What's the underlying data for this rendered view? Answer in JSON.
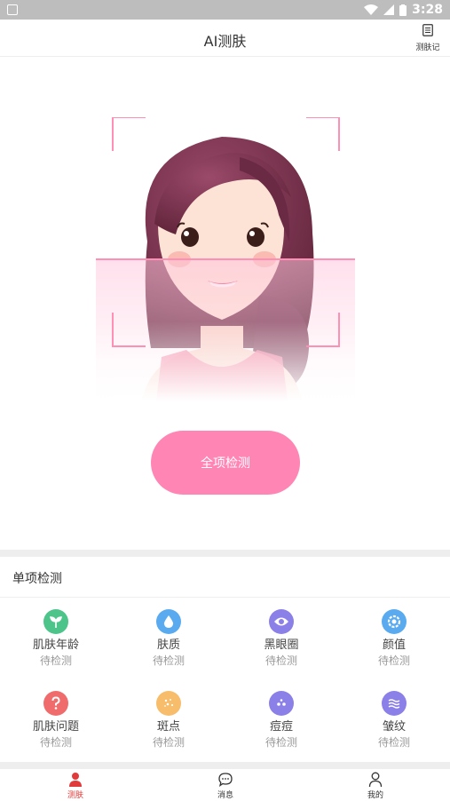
{
  "status_bar": {
    "time": "3:28"
  },
  "header": {
    "title": "AI测肤",
    "record_label": "测肤记"
  },
  "hero": {
    "cta_label": "全项检测"
  },
  "single_tests": {
    "section_title": "单项检测",
    "items": [
      {
        "name": "肌肤年龄",
        "status": "待检测",
        "icon": "sprout-icon",
        "color": "#4cc48a"
      },
      {
        "name": "肤质",
        "status": "待检测",
        "icon": "water-drop-icon",
        "color": "#5aaaf0"
      },
      {
        "name": "黑眼圈",
        "status": "待检测",
        "icon": "eye-icon",
        "color": "#8b7fe8"
      },
      {
        "name": "颜值",
        "status": "待检测",
        "icon": "flower-icon",
        "color": "#5aaaf0"
      },
      {
        "name": "肌肤问题",
        "status": "待检测",
        "icon": "question-icon",
        "color": "#f06c6c"
      },
      {
        "name": "斑点",
        "status": "待检测",
        "icon": "spots-icon",
        "color": "#f7bd6a"
      },
      {
        "name": "痘痘",
        "status": "待检测",
        "icon": "acne-icon",
        "color": "#8b7fe8"
      },
      {
        "name": "皱纹",
        "status": "待检测",
        "icon": "wrinkle-icon",
        "color": "#8b7fe8"
      }
    ]
  },
  "tabbar": {
    "tabs": [
      {
        "label": "测肤",
        "icon": "person-icon",
        "active": true
      },
      {
        "label": "消息",
        "icon": "message-icon",
        "active": false
      },
      {
        "label": "我的",
        "icon": "profile-icon",
        "active": false
      }
    ]
  },
  "colors": {
    "accent": "#ff85b4",
    "active_tab": "#e03a3a",
    "scan_line": "#ff8fb4"
  }
}
